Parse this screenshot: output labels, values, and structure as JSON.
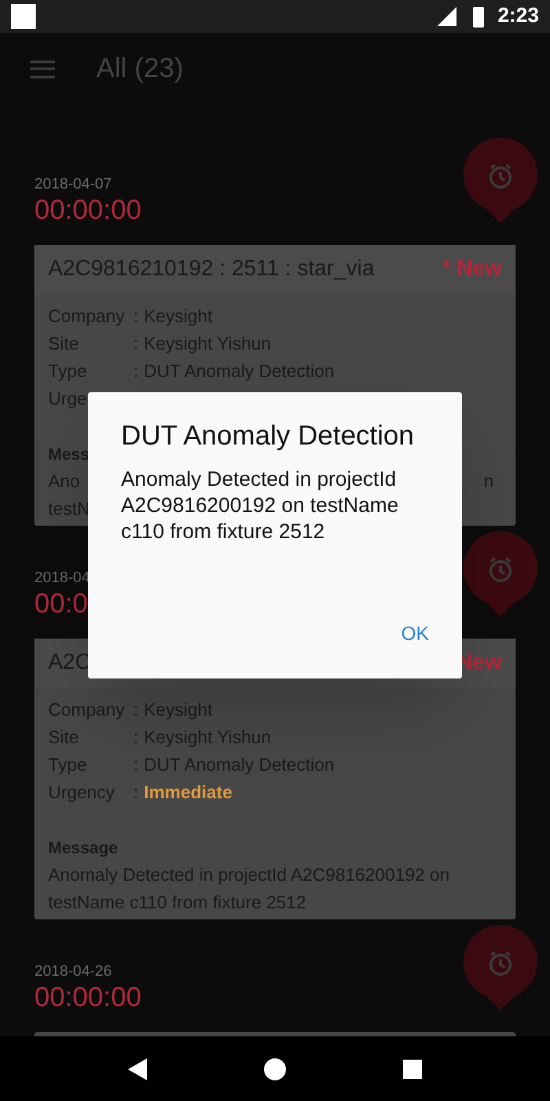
{
  "status_bar": {
    "time": "2:23"
  },
  "toolbar": {
    "title": "All (23)"
  },
  "alerts": [
    {
      "date": "2018-04-07",
      "time": "00:00:00",
      "card": {
        "header": "A2C9816210192 : 2511 : star_via",
        "new_mark": "* New",
        "fields": [
          {
            "kind": "plain",
            "label": "Company",
            "separator": ":",
            "value": "Keysight"
          },
          {
            "kind": "plain",
            "label": "Site",
            "separator": ":",
            "value": "Keysight Yishun"
          },
          {
            "kind": "plain",
            "label": "Type",
            "separator": ":",
            "value": "DUT Anomaly Detection"
          },
          {
            "label": "Urge"
          }
        ],
        "message_label": "Mess",
        "message_lines": [
          {
            "left": "Ano",
            "right": "n"
          },
          {
            "left": "testN"
          }
        ]
      }
    },
    {
      "date": "2018-04",
      "time": "00:0",
      "card": {
        "header": "A2C",
        "new_mark": "New",
        "fields": [
          {
            "kind": "plain",
            "label": "Company",
            "separator": ":",
            "value": "Keysight"
          },
          {
            "kind": "plain",
            "label": "Site",
            "separator": ":",
            "value": "Keysight Yishun"
          },
          {
            "kind": "plain",
            "label": "Type",
            "separator": ":",
            "value": "DUT Anomaly Detection"
          },
          {
            "kind": "urgency",
            "label": "Urgency",
            "separator": ":",
            "value": "Immediate"
          }
        ],
        "message_label": "Message",
        "message_lines": [
          {
            "left": "Anomaly Detected in projectId A2C9816200192 on"
          },
          {
            "left": "testName c110 from fixture 2512"
          }
        ]
      }
    },
    {
      "date": "2018-04-26",
      "time": "00:00:00",
      "card_stub": true
    }
  ],
  "dialog": {
    "title": "DUT Anomaly Detection",
    "body": "Anomaly Detected in projectId A2C9816200192 on testName c110 from fixture 2512",
    "button": "OK"
  }
}
